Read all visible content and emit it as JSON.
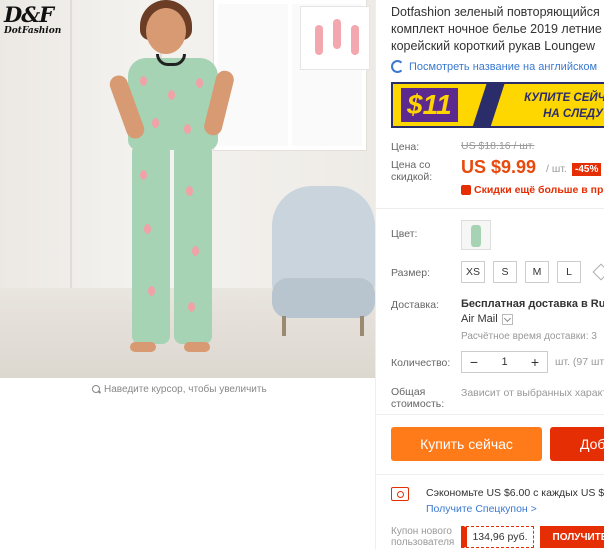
{
  "brand": {
    "monogram": "D&F",
    "name": "DotFashion"
  },
  "image_hint": "Наведите курсор, чтобы увеличить",
  "product": {
    "title_lines": [
      "Dotfashion зеленый повторяющийся",
      "комплект ночное белье 2019 летние",
      "корейский короткий рукав Loungew"
    ],
    "translate_link": "Посмотреть название на английском"
  },
  "promo": {
    "amount": "$11",
    "text_line1": "КУПИТЕ СЕЙЧАС",
    "text_line2": "НА СЛЕДУ"
  },
  "price": {
    "label": "Цена:",
    "old": "US $18.16 / шт.",
    "discount_label_line1": "Цена со",
    "discount_label_line2": "скидкой:",
    "current": "US $9.99",
    "unit": "/ шт.",
    "discount_badge": "-45%",
    "coupon_text": "Скидки ещё больше в при"
  },
  "color": {
    "label": "Цвет:"
  },
  "size": {
    "label": "Размер:",
    "options": [
      "XS",
      "S",
      "M",
      "L"
    ]
  },
  "shipping": {
    "label": "Доставка:",
    "main": "Бесплатная доставка в Russ",
    "method": "Air Mail",
    "time": "Расчётное время доставки: 3"
  },
  "quantity": {
    "label": "Количество:",
    "minus": "−",
    "value": "1",
    "plus": "+",
    "available": "шт. (97 шт"
  },
  "total": {
    "label_line1": "Общая",
    "label_line2": "стоимость:",
    "value": "Зависит от выбранных характ"
  },
  "actions": {
    "buy_now": "Купить сейчас",
    "add_to_cart": "Доба"
  },
  "savings": {
    "text": "Сэкономьте US $6.00 с каждых US $65",
    "link": "Получите Спецкупон >"
  },
  "new_user": {
    "label_line1": "Купон нового",
    "label_line2": "пользователя",
    "price": "134,96 руб.",
    "get_button": "ПОЛУЧИТЕ"
  },
  "colors": {
    "accent_orange": "#ff7b1a",
    "accent_red": "#e62e04",
    "price_orange": "#e8490c",
    "link_blue": "#3a79d0",
    "promo_yellow": "#ffd700"
  }
}
